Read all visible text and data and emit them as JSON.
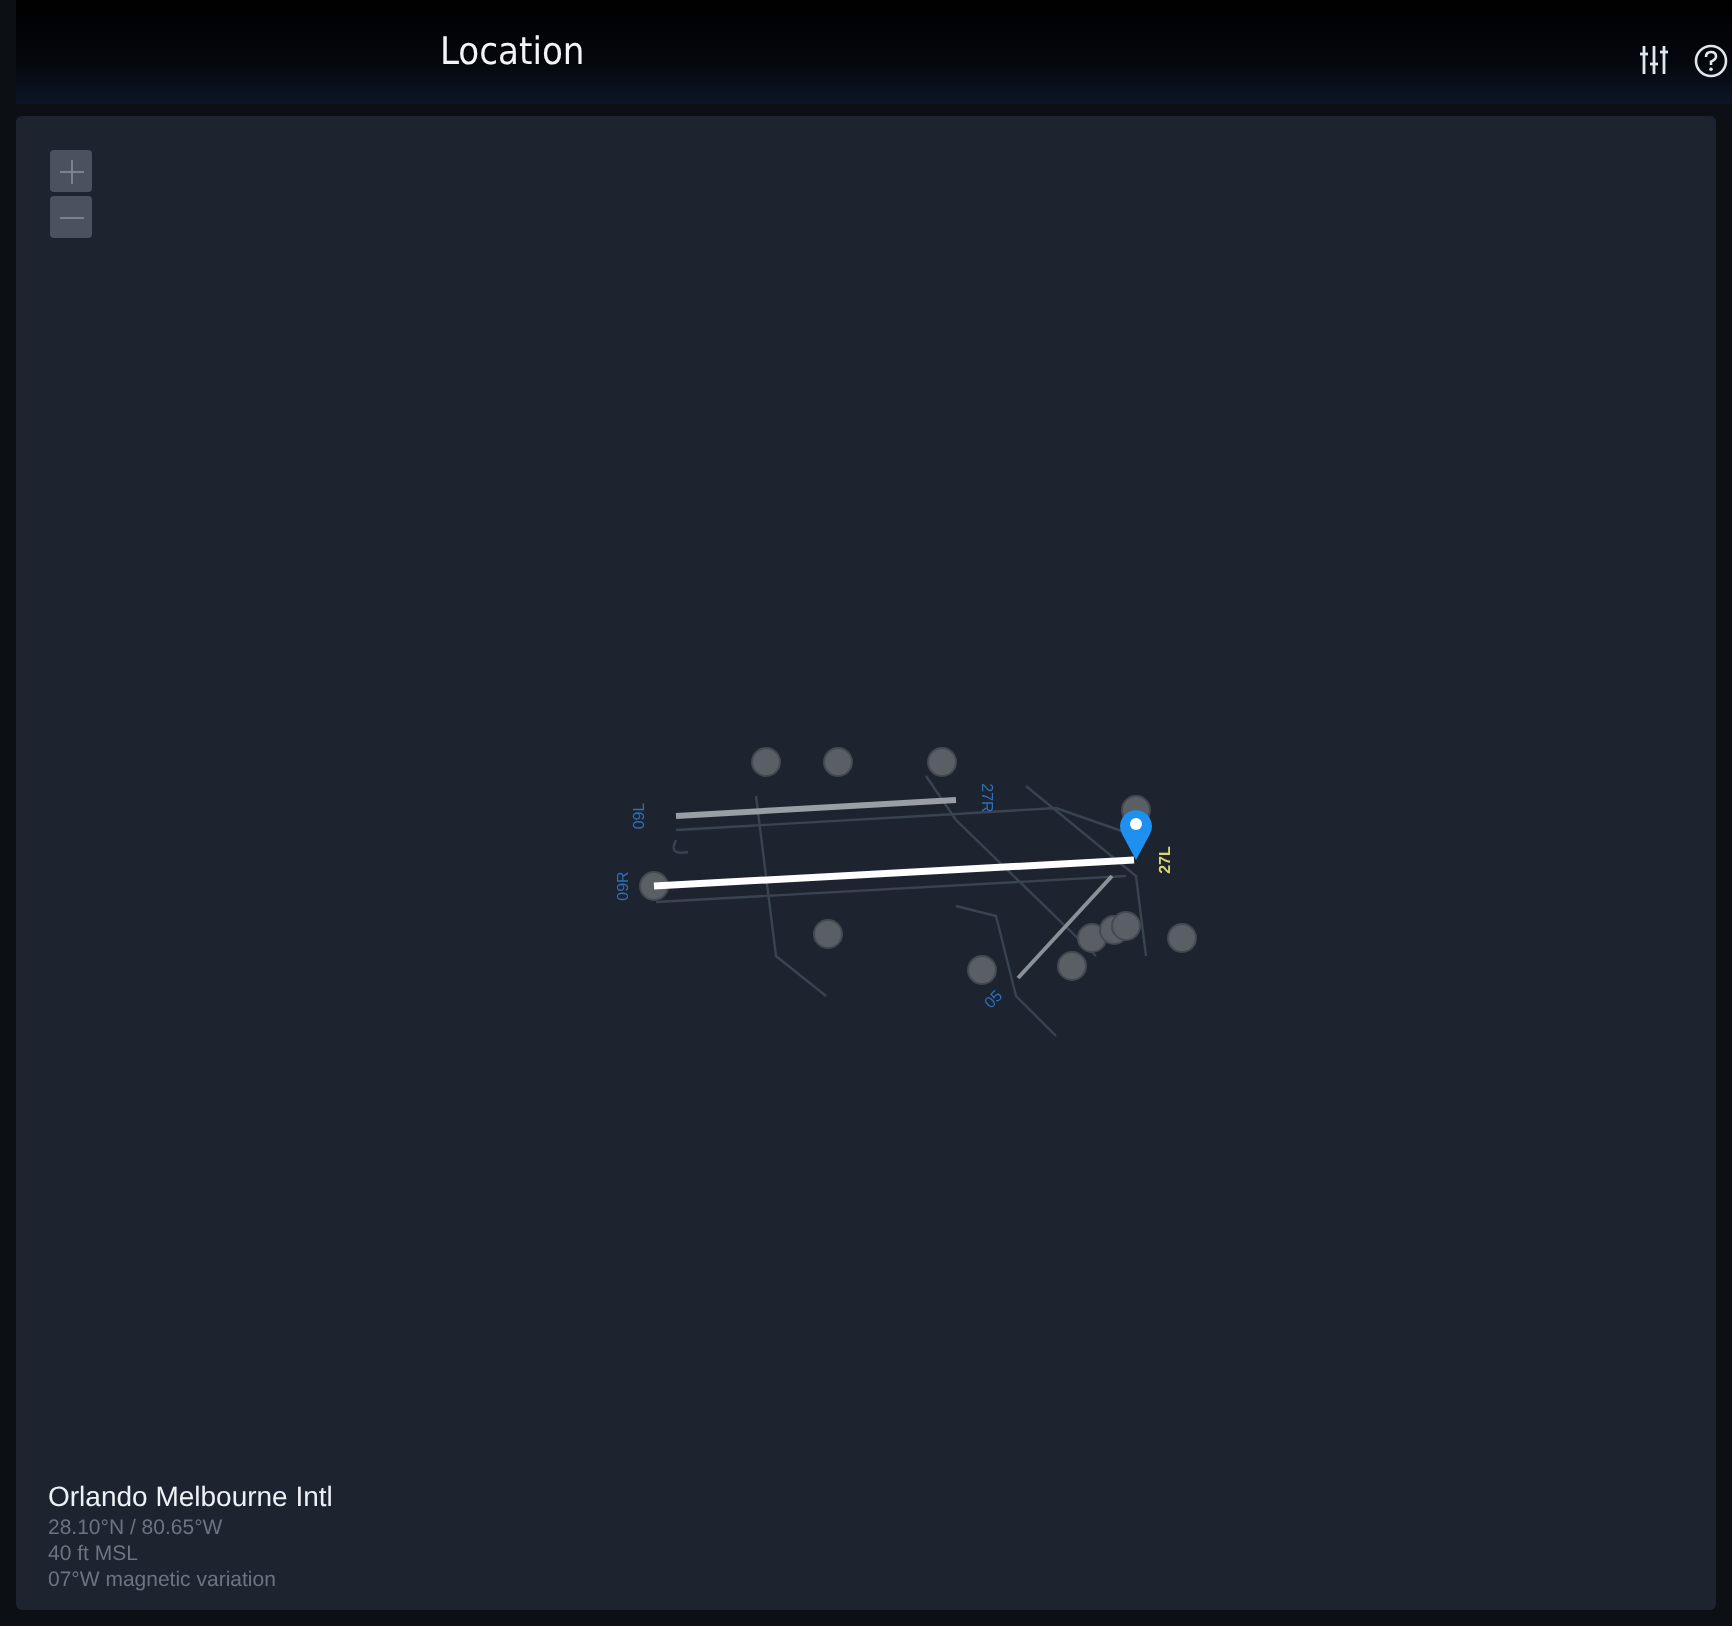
{
  "header": {
    "title": "Location"
  },
  "map": {
    "runway_labels": [
      {
        "label": "09L",
        "selected": false
      },
      {
        "label": "27R",
        "selected": false
      },
      {
        "label": "09R",
        "selected": false
      },
      {
        "label": "27L",
        "selected": true
      },
      {
        "label": "05",
        "selected": false
      }
    ]
  },
  "airport": {
    "name": "Orlando Melbourne Intl",
    "coordinates": "28.10°N / 80.65°W",
    "elevation": "40 ft MSL",
    "variation": "07°W magnetic variation"
  }
}
